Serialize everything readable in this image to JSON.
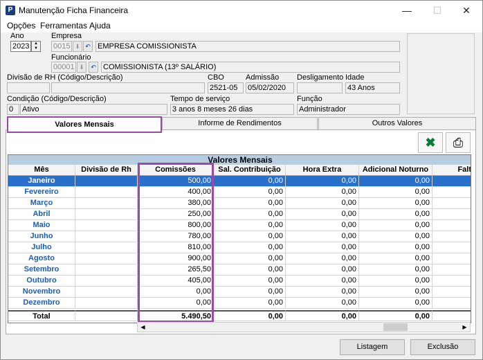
{
  "window": {
    "title": "Manutenção Ficha Financeira",
    "app_icon": "P",
    "minimize_glyph": "—",
    "maximize_glyph": "☐",
    "close_glyph": "✕"
  },
  "menu": [
    "Opções",
    "Ferramentas",
    "Ajuda"
  ],
  "form": {
    "ano_label": "Ano",
    "ano_value": "2023",
    "empresa_label": "Empresa",
    "empresa_code": "0015",
    "empresa_name": "EMPRESA COMISSIONISTA",
    "funcionario_label": "Funcionário",
    "funcionario_code": "00001",
    "funcionario_name": "COMISSIONISTA  (13º SALÁRIO)",
    "divisao_label": "Divisão de RH  (Código/Descrição)",
    "divisao_code": "",
    "divisao_desc": "",
    "cbo_label": "CBO",
    "cbo_value": "2521-05",
    "admissao_label": "Admissão",
    "admissao_value": "05/02/2020",
    "desligamento_label": "Desligamento",
    "desligamento_value": "",
    "idade_label": "Idade",
    "idade_value": "43 Anos",
    "condicao_label": "Condição (Código/Descrição)",
    "condicao_code": "0",
    "condicao_desc": "Ativo",
    "tempo_label": "Tempo de serviço",
    "tempo_value": "3 anos 8 meses 26 dias",
    "funcao_label": "Função",
    "funcao_value": "Administrador"
  },
  "tabs": [
    "Valores Mensais",
    "Informe de Rendimentos",
    "Outros Valores"
  ],
  "grid": {
    "title": "Valores Mensais",
    "columns": [
      "Mês",
      "Divisão de Rh",
      "Comissões",
      "Sal. Contribuição",
      "Hora Extra",
      "Adicional Noturno",
      "Falt"
    ],
    "rows": [
      {
        "mes": "Janeiro",
        "divisao": "",
        "comissoes": "500,00",
        "sal": "0,00",
        "hora": "0,00",
        "adic": "0,00"
      },
      {
        "mes": "Fevereiro",
        "divisao": "",
        "comissoes": "400,00",
        "sal": "0,00",
        "hora": "0,00",
        "adic": "0,00"
      },
      {
        "mes": "Março",
        "divisao": "",
        "comissoes": "380,00",
        "sal": "0,00",
        "hora": "0,00",
        "adic": "0,00"
      },
      {
        "mes": "Abril",
        "divisao": "",
        "comissoes": "250,00",
        "sal": "0,00",
        "hora": "0,00",
        "adic": "0,00"
      },
      {
        "mes": "Maio",
        "divisao": "",
        "comissoes": "800,00",
        "sal": "0,00",
        "hora": "0,00",
        "adic": "0,00"
      },
      {
        "mes": "Junho",
        "divisao": "",
        "comissoes": "780,00",
        "sal": "0,00",
        "hora": "0,00",
        "adic": "0,00"
      },
      {
        "mes": "Julho",
        "divisao": "",
        "comissoes": "810,00",
        "sal": "0,00",
        "hora": "0,00",
        "adic": "0,00"
      },
      {
        "mes": "Agosto",
        "divisao": "",
        "comissoes": "900,00",
        "sal": "0,00",
        "hora": "0,00",
        "adic": "0,00"
      },
      {
        "mes": "Setembro",
        "divisao": "",
        "comissoes": "265,50",
        "sal": "0,00",
        "hora": "0,00",
        "adic": "0,00"
      },
      {
        "mes": "Outubro",
        "divisao": "",
        "comissoes": "405,00",
        "sal": "0,00",
        "hora": "0,00",
        "adic": "0,00"
      },
      {
        "mes": "Novembro",
        "divisao": "",
        "comissoes": "0,00",
        "sal": "0,00",
        "hora": "0,00",
        "adic": "0,00"
      },
      {
        "mes": "Dezembro",
        "divisao": "",
        "comissoes": "0,00",
        "sal": "0,00",
        "hora": "0,00",
        "adic": "0,00"
      }
    ],
    "total": {
      "label": "Total",
      "comissoes": "5.490,50",
      "sal": "0,00",
      "hora": "0,00",
      "adic": "0,00"
    }
  },
  "buttons": {
    "listagem": "Listagem",
    "exclusao": "Exclusão"
  },
  "colors": {
    "accent": "#9b4aa7",
    "selection": "#2a6fc9",
    "month_text": "#1a5fb4"
  }
}
